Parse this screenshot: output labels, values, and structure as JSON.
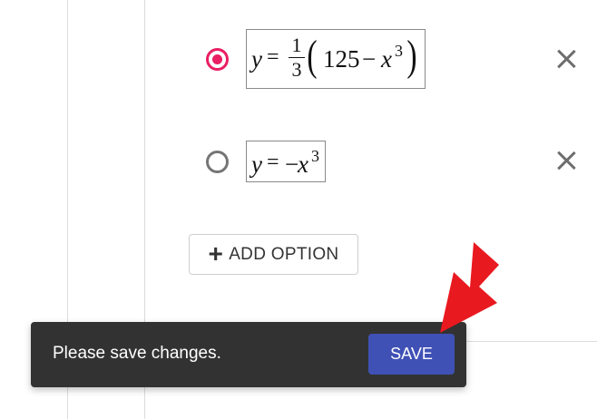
{
  "options": [
    {
      "selected": true,
      "formula": {
        "lhs": "y",
        "eq": "=",
        "frac_num": "1",
        "frac_den": "3",
        "open_paren": "(",
        "body": "125",
        "minus": "−",
        "var": "x",
        "exp": "3",
        "close_paren": ")"
      }
    },
    {
      "selected": false,
      "formula": {
        "lhs": "y",
        "eq": "=",
        "neg": "−",
        "var": "x",
        "exp": "3"
      }
    }
  ],
  "add_option": {
    "icon": "plus-icon",
    "plus_glyph": "+",
    "label": "ADD OPTION"
  },
  "snackbar": {
    "message": "Please save changes.",
    "save_label": "SAVE"
  },
  "colors": {
    "radio_selected": "#e91e63",
    "radio_unselected": "#757575",
    "snackbar_bg": "#323232",
    "save_button": "#3f51b5",
    "arrow": "#e8191f"
  }
}
